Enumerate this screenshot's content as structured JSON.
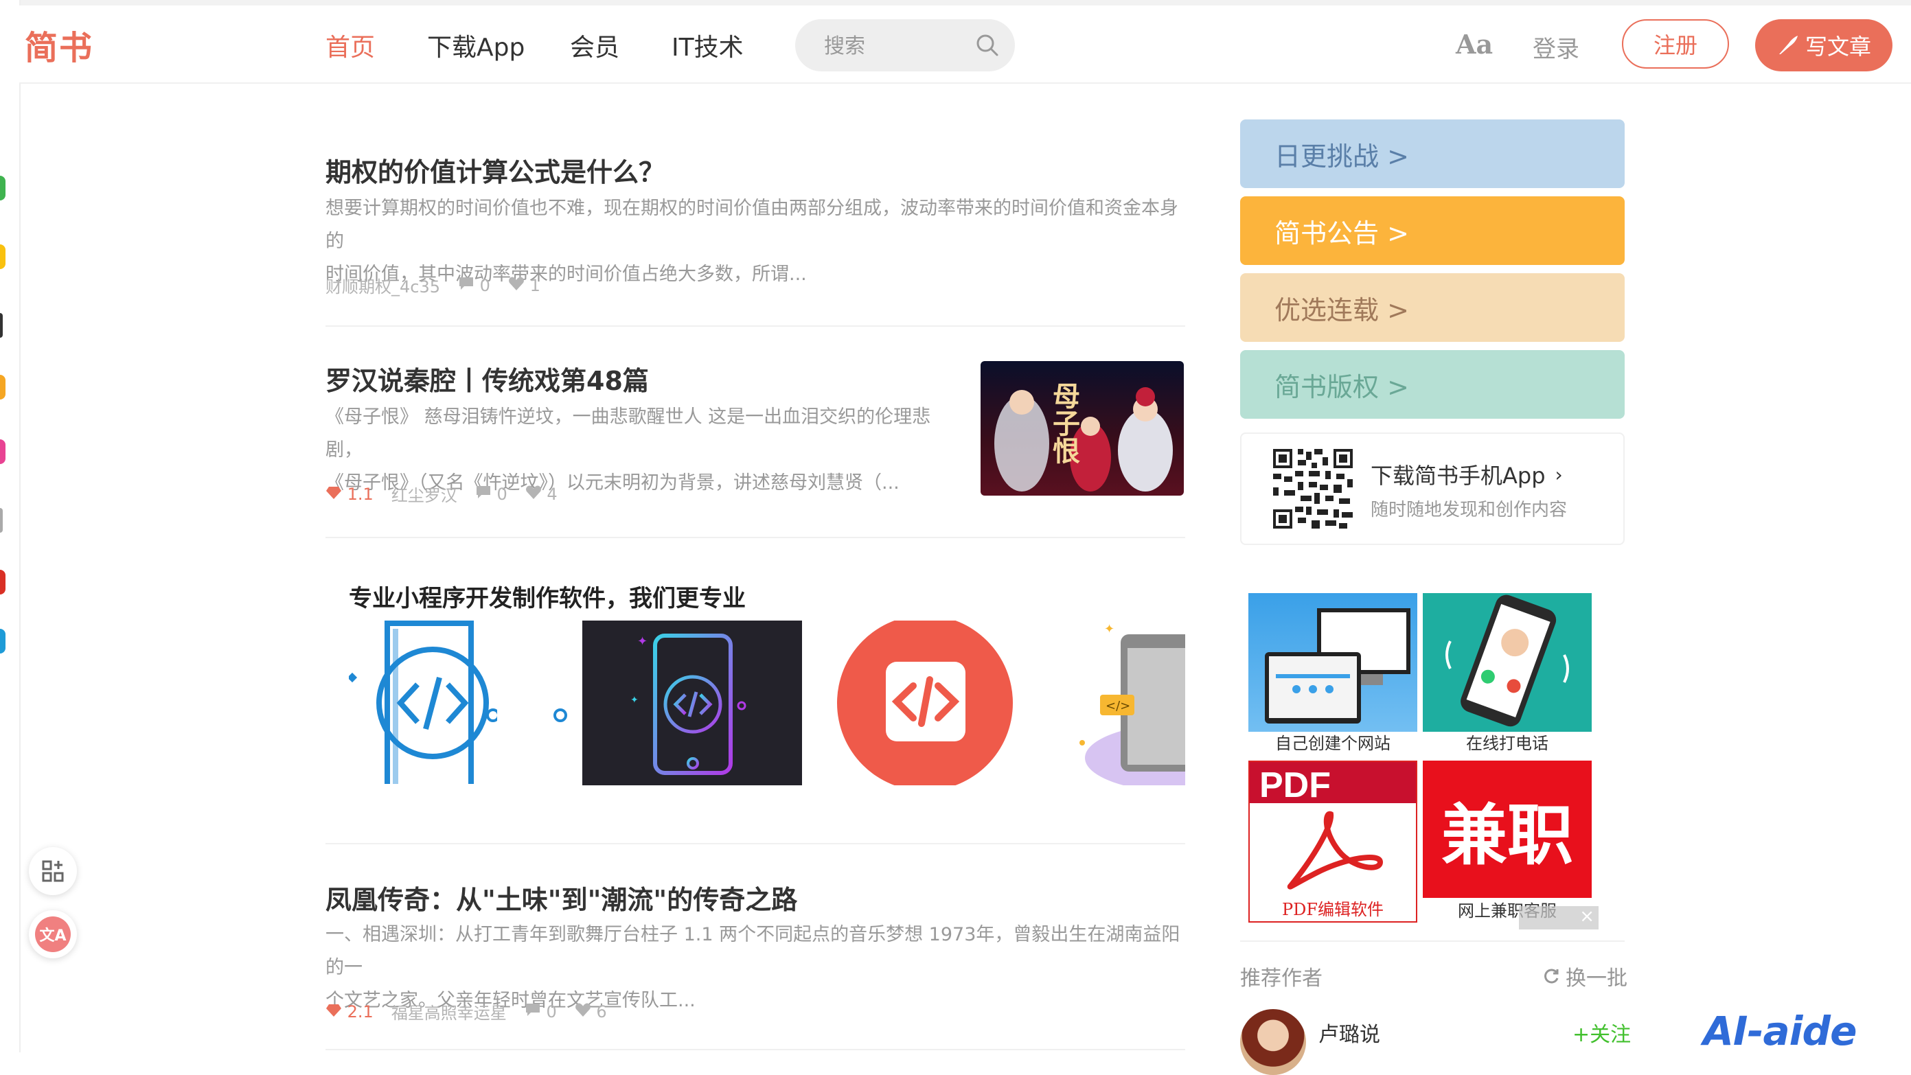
{
  "logo": "简书",
  "nav": {
    "items": [
      "首页",
      "下载App",
      "会员",
      "IT技术"
    ],
    "active_index": 0
  },
  "search": {
    "placeholder": "搜索"
  },
  "header": {
    "font_toggle": "Aa",
    "login": "登录",
    "register": "注册",
    "write": "写文章"
  },
  "articles": [
    {
      "title": "期权的价值计算公式是什么？",
      "abstract_lines": [
        "想要计算期权的时间价值也不难，现在期权的时间价值由两部分组成，波动率带来的时间价值和资金本身的",
        "时间价值，其中波动率带来的时间价值占绝大多数，所谓..."
      ],
      "author": "财顺期权_4c35",
      "comments": "0",
      "likes": "1"
    },
    {
      "title": "罗汉说秦腔丨传统戏第48篇",
      "abstract_lines": [
        "《母子恨》 慈母泪铸忤逆坟，一曲悲歌醒世人 这是一出血泪交织的伦理悲剧，",
        "《母子恨》（又名《忤逆坟》）以元末明初为背景，讲述慈母刘慧贤（..."
      ],
      "diamonds": "1.1",
      "author": "红尘罗汉",
      "comments": "0",
      "likes": "4",
      "thumb_text": "母子恨"
    },
    {
      "title": "凤凰传奇：从\"土味\"到\"潮流\"的传奇之路",
      "abstract_lines": [
        "一、相遇深圳：从打工青年到歌舞厅台柱子 1.1 两个不同起点的音乐梦想 1973年，曾毅出生在湖南益阳的一",
        "个文艺之家。父亲年轻时曾在文艺宣传队工..."
      ],
      "diamonds": "2.1",
      "author": "福星高照幸运星",
      "comments": "0",
      "likes": "6"
    }
  ],
  "promo": {
    "title": "专业小程序开发制作软件，我们更专业"
  },
  "side": {
    "buttons": [
      {
        "label": "日更挑战  >",
        "bg": "#bcd6ec",
        "color": "#5a7fa8"
      },
      {
        "label": "简书公告  >",
        "bg": "#fcb43c",
        "color": "#ffffff"
      },
      {
        "label": "优选连载  >",
        "bg": "#f6dcb4",
        "color": "#a0795a"
      },
      {
        "label": "简书版权  >",
        "bg": "#b6e0d4",
        "color": "#6aa896"
      }
    ],
    "app_title": "下载简书手机App",
    "app_sub": "随时随地发现和创作内容"
  },
  "ads": [
    {
      "caption": "自己创建个网站"
    },
    {
      "caption": "在线打电话"
    },
    {
      "caption": "PDF编辑软件",
      "image_text": "PDF"
    },
    {
      "caption": "网上兼职客服",
      "image_text": "兼职"
    }
  ],
  "recommend": {
    "title": "推荐作者",
    "refresh": "换一批",
    "author_name": "卢璐说",
    "follow": "+关注"
  },
  "watermark": "AI-aide",
  "colors": {
    "brand": "#ea6f5a",
    "follow": "#42c02e"
  }
}
